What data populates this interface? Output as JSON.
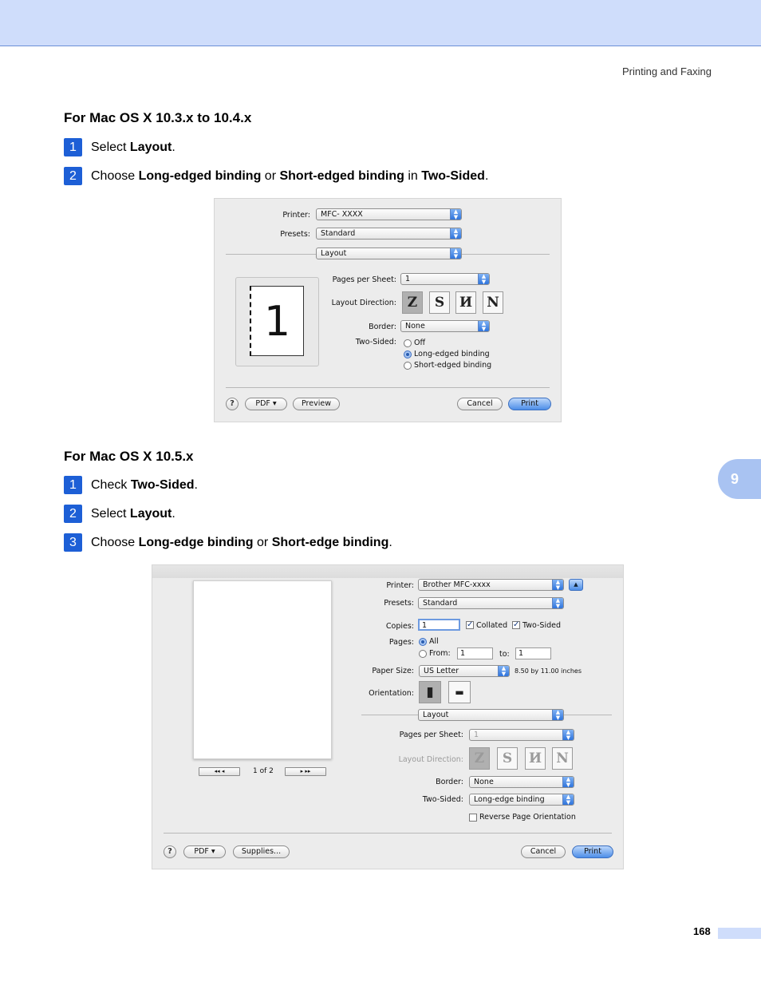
{
  "header": {
    "section_title": "Printing and Faxing"
  },
  "chapter_tab": "9",
  "page_number": "168",
  "section1": {
    "heading": "For Mac OS X 10.3.x to 10.4.x",
    "steps": [
      {
        "num": "1",
        "pre": "Select ",
        "b1": "Layout",
        "mid": ".",
        "b2": "",
        "post": "",
        "b3": "",
        "end": ""
      },
      {
        "num": "2",
        "pre": "Choose ",
        "b1": "Long-edged binding",
        "mid": " or ",
        "b2": "Short-edged binding",
        "post": " in ",
        "b3": "Two-Sided",
        "end": "."
      }
    ]
  },
  "section2": {
    "heading": "For Mac OS X 10.5.x",
    "steps": [
      {
        "num": "1",
        "pre": "Check ",
        "b1": "Two-Sided",
        "mid": ".",
        "b2": "",
        "post": "",
        "b3": "",
        "end": ""
      },
      {
        "num": "2",
        "pre": "Select ",
        "b1": "Layout",
        "mid": ".",
        "b2": "",
        "post": "",
        "b3": "",
        "end": ""
      },
      {
        "num": "3",
        "pre": "Choose ",
        "b1": "Long-edge binding",
        "mid": " or ",
        "b2": "Short-edge binding",
        "post": ".",
        "b3": "",
        "end": ""
      }
    ]
  },
  "dialog1": {
    "printer_label": "Printer:",
    "printer_value": "MFC- XXXX",
    "presets_label": "Presets:",
    "presets_value": "Standard",
    "panel_value": "Layout",
    "preview_number": "1",
    "pps_label": "Pages per Sheet:",
    "pps_value": "1",
    "layout_dir_label": "Layout Direction:",
    "border_label": "Border:",
    "border_value": "None",
    "two_sided_label": "Two-Sided:",
    "two_sided_options": [
      "Off",
      "Long-edged binding",
      "Short-edged binding"
    ],
    "two_sided_selected": "Long-edged binding",
    "help": "?",
    "pdf_button": "PDF ▾",
    "preview_button": "Preview",
    "cancel_button": "Cancel",
    "print_button": "Print"
  },
  "dialog2": {
    "printer_label": "Printer:",
    "printer_value": "Brother MFC-xxxx",
    "presets_label": "Presets:",
    "presets_value": "Standard",
    "copies_label": "Copies:",
    "copies_value": "1",
    "collated_label": "Collated",
    "two_sided_check_label": "Two-Sided",
    "pages_label": "Pages:",
    "pages_all": "All",
    "pages_from": "From:",
    "from_value": "1",
    "to_label": "to:",
    "to_value": "1",
    "paper_size_label": "Paper Size:",
    "paper_size_value": "US Letter",
    "paper_size_dims": "8.50 by 11.00 inches",
    "orientation_label": "Orientation:",
    "panel_value": "Layout",
    "pps_label": "Pages per Sheet:",
    "pps_value": "1",
    "layout_dir_label": "Layout Direction:",
    "border_label": "Border:",
    "border_value": "None",
    "two_sided_label": "Two-Sided:",
    "two_sided_value": "Long-edge binding",
    "reverse_label": "Reverse Page Orientation",
    "page_counter": "1 of 2",
    "help": "?",
    "pdf_button": "PDF ▾",
    "supplies_button": "Supplies...",
    "cancel_button": "Cancel",
    "print_button": "Print"
  }
}
